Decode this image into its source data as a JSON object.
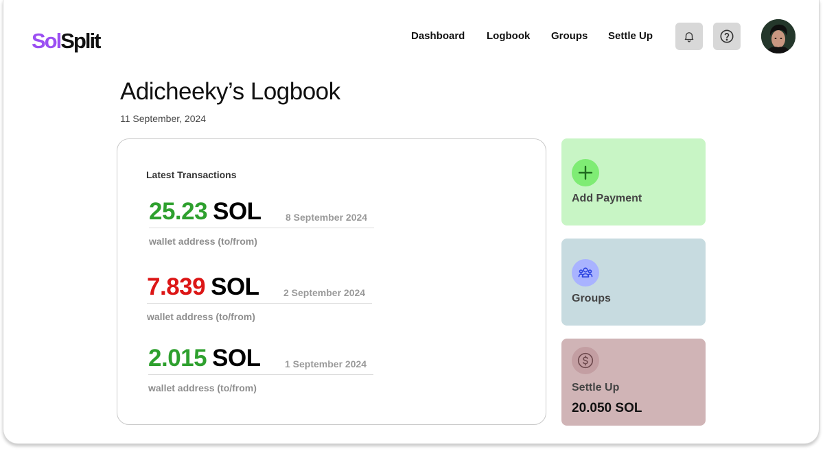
{
  "brand": {
    "part1": "Sol",
    "part2": "Split"
  },
  "nav": {
    "items": [
      {
        "label": "Dashboard"
      },
      {
        "label": "Logbook"
      },
      {
        "label": "Groups"
      },
      {
        "label": "Settle Up"
      }
    ],
    "icons": [
      "bell-icon",
      "help-icon"
    ]
  },
  "page": {
    "title": "Adicheeky’s Logbook",
    "date": "11 September, 2024"
  },
  "transactions": {
    "heading": "Latest Transactions",
    "items": [
      {
        "amount": "25.23",
        "unit": "SOL",
        "date": "8 September 2024",
        "wallet": "wallet address (to/from)",
        "direction": "incoming",
        "color": "#2ea02e"
      },
      {
        "amount": "7.839",
        "unit": "SOL",
        "date": "2 September 2024",
        "wallet": "wallet address (to/from)",
        "direction": "outgoing",
        "color": "#dc1616"
      },
      {
        "amount": "2.015",
        "unit": "SOL",
        "date": "1 September 2024",
        "wallet": "wallet address (to/from)",
        "direction": "incoming",
        "color": "#2ea02e"
      }
    ]
  },
  "actions": {
    "add_payment": {
      "label": "Add Payment",
      "icon": "plus-icon",
      "bg": "#c8f5c5",
      "icon_bg": "#7fec74"
    },
    "groups": {
      "label": "Groups",
      "icon": "people-icon",
      "bg": "#c7dbe0",
      "icon_bg": "#a9b3ff"
    },
    "settle_up": {
      "label": "Settle Up",
      "value": "20.050 SOL",
      "icon": "dollar-icon",
      "bg": "#d0b4b6",
      "icon_bg": "#c39ea2"
    }
  }
}
